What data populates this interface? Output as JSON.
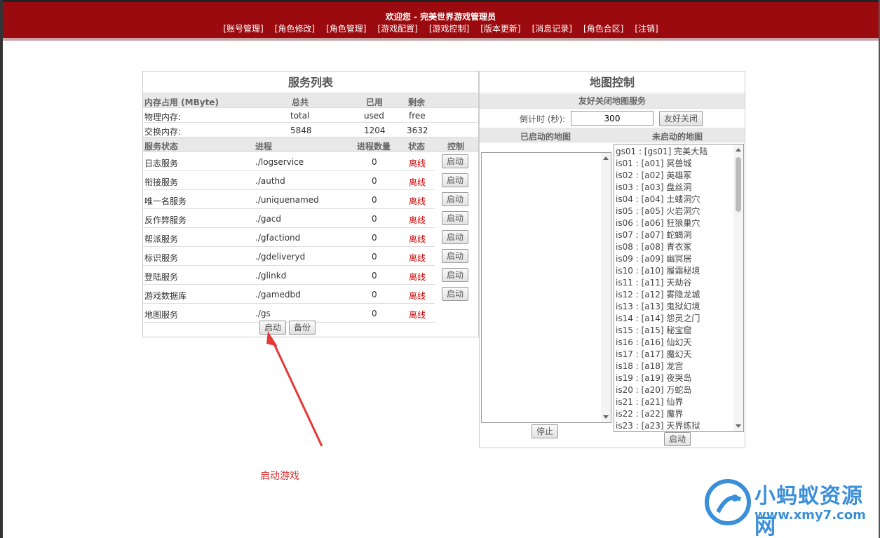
{
  "header": {
    "welcome": "欢迎您 - 完美世界游戏管理员",
    "nav": [
      "[账号管理]",
      "[角色修改]",
      "[角色管理]",
      "[游戏配置]",
      "[游戏控制]",
      "[版本更新]",
      "[消息记录]",
      "[角色合区]",
      "[注销]"
    ]
  },
  "services": {
    "title": "服务列表",
    "mem_header": [
      "内存占用 (MByte)",
      "总共",
      "已用",
      "剩余"
    ],
    "mem_rows": [
      [
        "物理内存:",
        "total",
        "used",
        "free"
      ],
      [
        "交换内存:",
        "5848",
        "1204",
        "3632"
      ]
    ],
    "svc_header": [
      "服务状态",
      "进程",
      "进程数量",
      "状态",
      "控制"
    ],
    "rows": [
      {
        "name": "日志服务",
        "proc": "./logservice",
        "count": "0",
        "status": "离线",
        "btn": "启动"
      },
      {
        "name": "衔接服务",
        "proc": "./authd",
        "count": "0",
        "status": "离线",
        "btn": "启动"
      },
      {
        "name": "唯一名服务",
        "proc": "./uniquenamed",
        "count": "0",
        "status": "离线",
        "btn": "启动"
      },
      {
        "name": "反作弊服务",
        "proc": "./gacd",
        "count": "0",
        "status": "离线",
        "btn": "启动"
      },
      {
        "name": "帮派服务",
        "proc": "./gfactiond",
        "count": "0",
        "status": "离线",
        "btn": "启动"
      },
      {
        "name": "标识服务",
        "proc": "./gdeliveryd",
        "count": "0",
        "status": "离线",
        "btn": "启动"
      },
      {
        "name": "登陆服务",
        "proc": "./glinkd",
        "count": "0",
        "status": "离线",
        "btn": "启动"
      },
      {
        "name": "游戏数据库",
        "proc": "./gamedbd",
        "count": "0",
        "status": "离线",
        "btn": "启动"
      },
      {
        "name": "地图服务",
        "proc": "./gs",
        "count": "0",
        "status": "离线",
        "btn": ""
      }
    ],
    "start_all": "启动",
    "backup": "备份"
  },
  "map": {
    "title": "地图控制",
    "friendly_close_title": "友好关闭地图服务",
    "countdown_label": "倒计时 (秒):",
    "countdown_value": "300",
    "friendly_close_btn": "友好关闭",
    "started_label": "已启动的地图",
    "not_started_label": "未启动的地图",
    "stop_btn": "停止",
    "start_btn": "启动",
    "not_started": [
      "gs01 : [gs01] 完美大陆",
      "is01 : [a01] 冥兽城",
      "is02 : [a02] 英雄冢",
      "is03 : [a03] 盘丝洞",
      "is04 : [a04] 土蝼洞穴",
      "is05 : [a05] 火岩洞穴",
      "is06 : [a06] 狂狼巢穴",
      "is07 : [a07] 蛇蝎洞",
      "is08 : [a08] 青衣冢",
      "is09 : [a09] 幽冥居",
      "is10 : [a10] 履霜秘境",
      "is11 : [a11] 天劫谷",
      "is12 : [a12] 雾隐龙城",
      "is13 : [a13] 鬼狱幻境",
      "is14 : [a14] 怨灵之门",
      "is15 : [a15] 秘宝窟",
      "is16 : [a16] 仙幻天",
      "is17 : [a17] 魔幻天",
      "is18 : [a18] 龙宫",
      "is19 : [a19] 夜哭岛",
      "is20 : [a20] 万蛇岛",
      "is21 : [a21] 仙界",
      "is22 : [a22] 魔界",
      "is23 : [a23] 天界炼狱"
    ]
  },
  "annotation": "启动游戏",
  "watermark": {
    "title": "小蚂蚁资源网",
    "url": "www.xmy7.com"
  },
  "colors": {
    "header": "#9b0a0e",
    "offline": "#cc0000",
    "annotation": "#dd3333",
    "watermark": "#3b8fd9"
  }
}
